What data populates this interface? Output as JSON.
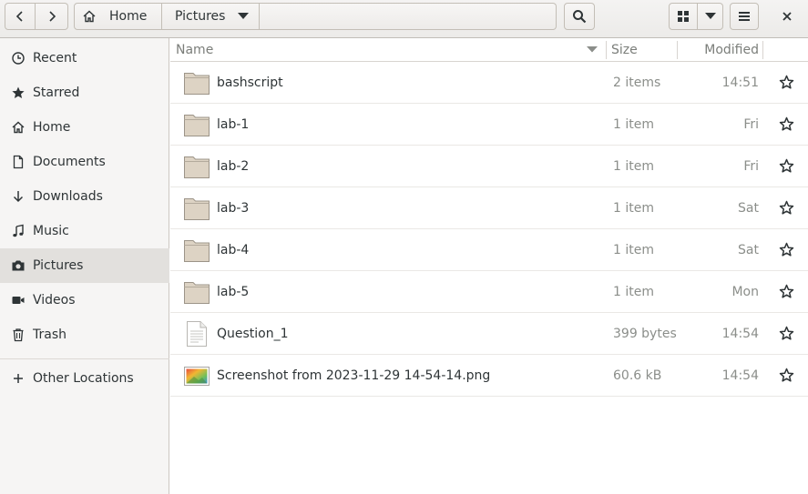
{
  "header": {
    "back_icon": "go-back-icon",
    "forward_icon": "go-forward-icon",
    "crumbs": [
      {
        "label": "Home",
        "icon": "home-icon"
      },
      {
        "label": "Pictures"
      }
    ],
    "crumb_menu_icon": "chevron-down-icon",
    "search_icon": "search-icon",
    "view_icon": "grid-view-icon",
    "view_menu_icon": "chevron-down-icon",
    "menu_icon": "hamburger-icon",
    "close_icon": "close-icon"
  },
  "sidebar": {
    "items": [
      {
        "label": "Recent",
        "icon": "clock-icon"
      },
      {
        "label": "Starred",
        "icon": "star-icon"
      },
      {
        "label": "Home",
        "icon": "home-icon"
      },
      {
        "label": "Documents",
        "icon": "document-icon"
      },
      {
        "label": "Downloads",
        "icon": "download-icon"
      },
      {
        "label": "Music",
        "icon": "music-icon"
      },
      {
        "label": "Pictures",
        "icon": "camera-icon",
        "selected": true
      },
      {
        "label": "Videos",
        "icon": "video-icon"
      },
      {
        "label": "Trash",
        "icon": "trash-icon"
      }
    ],
    "other_locations": {
      "label": "Other Locations",
      "icon": "plus-icon"
    }
  },
  "columns": {
    "name": "Name",
    "size": "Size",
    "modified": "Modified"
  },
  "files": [
    {
      "name": "bashscript",
      "size": "2 items",
      "modified": "14:51",
      "type": "folder"
    },
    {
      "name": "lab-1",
      "size": "1 item",
      "modified": "Fri",
      "type": "folder"
    },
    {
      "name": "lab-2",
      "size": "1 item",
      "modified": "Fri",
      "type": "folder"
    },
    {
      "name": "lab-3",
      "size": "1 item",
      "modified": "Sat",
      "type": "folder"
    },
    {
      "name": "lab-4",
      "size": "1 item",
      "modified": "Sat",
      "type": "folder"
    },
    {
      "name": "lab-5",
      "size": "1 item",
      "modified": "Mon",
      "type": "folder"
    },
    {
      "name": "Question_1",
      "size": "399 bytes",
      "modified": "14:54",
      "type": "text"
    },
    {
      "name": "Screenshot from 2023-11-29 14-54-14.png",
      "size": "60.6 kB",
      "modified": "14:54",
      "type": "image"
    }
  ],
  "colors": {
    "header_bg": "#ecebe9",
    "sidebar_bg": "#f6f5f4",
    "selected_bg": "#e2e0dd",
    "folder_fill": "#e0d7c9"
  }
}
